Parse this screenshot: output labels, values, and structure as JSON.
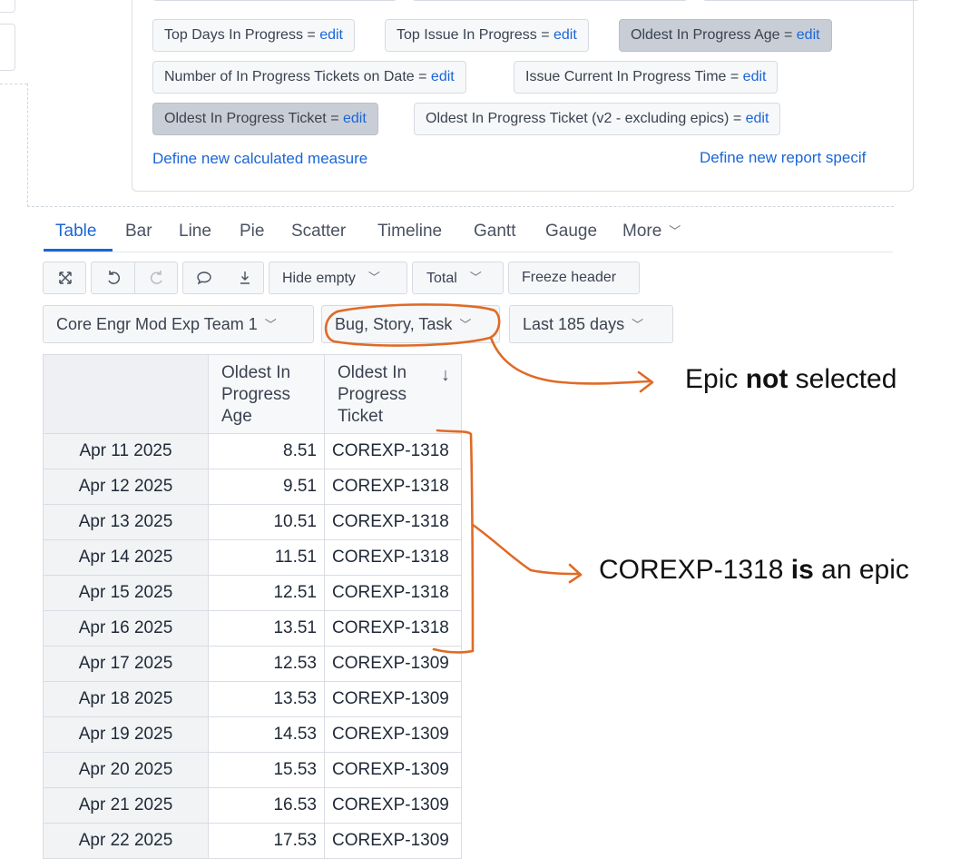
{
  "measures": {
    "chips": [
      {
        "name": "Top Days In Progress",
        "edit": "edit",
        "selected": false
      },
      {
        "name": "Top Issue In Progress",
        "edit": "edit",
        "selected": false
      },
      {
        "name": "Oldest In Progress Age",
        "edit": "edit",
        "selected": true
      },
      {
        "name": "Number of In Progress Tickets on Date",
        "edit": "edit",
        "selected": false
      },
      {
        "name": "Issue Current In Progress Time",
        "edit": "edit",
        "selected": false
      },
      {
        "name": "Oldest In Progress Ticket",
        "edit": "edit",
        "selected": true
      },
      {
        "name": "Oldest In Progress Ticket (v2 - excluding epics)",
        "edit": "edit",
        "selected": false
      }
    ],
    "eq": "=",
    "define_calc": "Define new calculated measure",
    "define_report": "Define new report specif"
  },
  "tabs": [
    "Table",
    "Bar",
    "Line",
    "Pie",
    "Scatter",
    "Timeline",
    "Gantt",
    "Gauge",
    "More"
  ],
  "active_tab": "Table",
  "toolbar": {
    "icons": [
      "expand-icon",
      "undo-icon",
      "redo-icon",
      "comment-icon",
      "download-icon"
    ],
    "hide_empty": "Hide empty",
    "total": "Total",
    "freeze_header": "Freeze header"
  },
  "filters": {
    "team": "Core Engr Mod Exp Team 1",
    "issue_types": "Bug, Story, Task",
    "period": "Last 185 days"
  },
  "table": {
    "headers": [
      "Oldest In Progress Age",
      "Oldest In Progress Ticket"
    ],
    "header_lines": [
      [
        "Oldest In",
        "Progress",
        "Age"
      ],
      [
        "Oldest In",
        "Progress",
        "Ticket"
      ]
    ],
    "sort_indicator": "↓",
    "rows": [
      {
        "date": "Apr 11 2025",
        "age": "8.51",
        "ticket": "COREXP-1318"
      },
      {
        "date": "Apr 12 2025",
        "age": "9.51",
        "ticket": "COREXP-1318"
      },
      {
        "date": "Apr 13 2025",
        "age": "10.51",
        "ticket": "COREXP-1318"
      },
      {
        "date": "Apr 14 2025",
        "age": "11.51",
        "ticket": "COREXP-1318"
      },
      {
        "date": "Apr 15 2025",
        "age": "12.51",
        "ticket": "COREXP-1318"
      },
      {
        "date": "Apr 16 2025",
        "age": "13.51",
        "ticket": "COREXP-1318"
      },
      {
        "date": "Apr 17 2025",
        "age": "12.53",
        "ticket": "COREXP-1309"
      },
      {
        "date": "Apr 18 2025",
        "age": "13.53",
        "ticket": "COREXP-1309"
      },
      {
        "date": "Apr 19 2025",
        "age": "14.53",
        "ticket": "COREXP-1309"
      },
      {
        "date": "Apr 20 2025",
        "age": "15.53",
        "ticket": "COREXP-1309"
      },
      {
        "date": "Apr 21 2025",
        "age": "16.53",
        "ticket": "COREXP-1309"
      },
      {
        "date": "Apr 22 2025",
        "age": "17.53",
        "ticket": "COREXP-1309"
      }
    ]
  },
  "annotations": {
    "epic_not_selected": {
      "before": "Epic ",
      "bold": "not",
      "after": " selected"
    },
    "corexp_is_epic": {
      "before": "COREXP-1318 ",
      "bold": "is",
      "after": " an epic"
    },
    "color": "#e06a26"
  }
}
